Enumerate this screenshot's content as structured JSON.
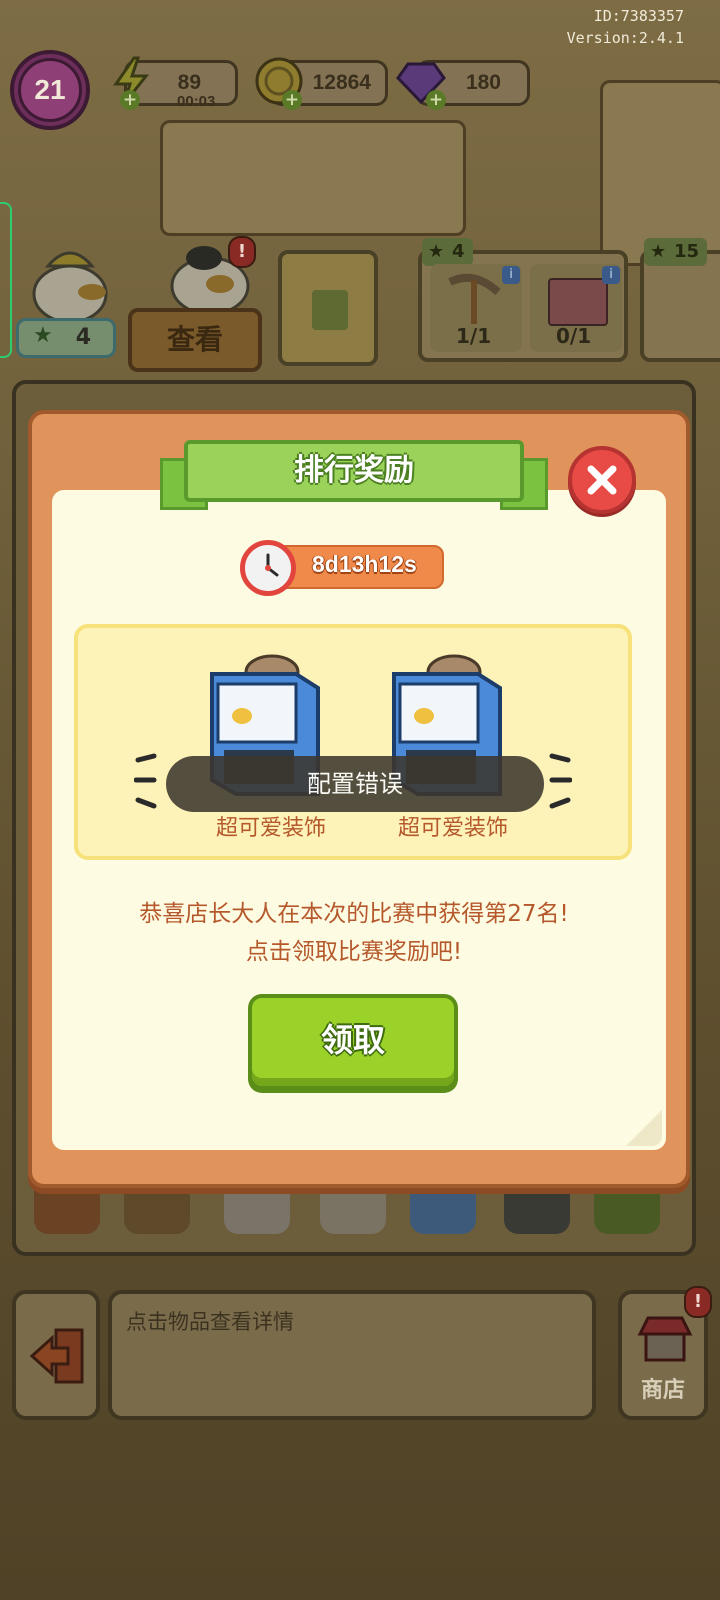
{
  "header": {
    "id_text": "ID:7383357",
    "version_text": "Version:2.4.1",
    "level": "21",
    "energy": {
      "value": "89",
      "timer": "00:03",
      "icon": "lightning-icon"
    },
    "coins": {
      "value": "12864",
      "icon": "coin-icon"
    },
    "gems": {
      "value": "180",
      "icon": "gem-icon"
    }
  },
  "scene": {
    "worker_star_count": "4",
    "view_button": "查看",
    "quest_cards": [
      {
        "star": "4",
        "progress": "1/1",
        "icon": "pickaxe-icon"
      },
      {
        "star": "",
        "progress": "0/1",
        "icon": "basket-icon"
      },
      {
        "star": "15",
        "progress": "",
        "icon": "card-icon"
      }
    ],
    "hint_text": "点击物品查看详情",
    "shop_label": "商店",
    "tray_icons": [
      "sausage-icon",
      "vendor-stall-icon",
      "statue-icon",
      "mushroom-icon",
      "cpu-chip-icon",
      "tire-icon",
      "tank-icon"
    ]
  },
  "modal": {
    "title": "排行奖励",
    "countdown": "8d13h12s",
    "rewards": [
      {
        "label": "超可爱装饰",
        "icon": "vending-machine-icon"
      },
      {
        "label": "超可爱装饰",
        "icon": "vending-machine-icon"
      }
    ],
    "error_toast": "配置错误",
    "message_line1": "恭喜店长大人在本次的比赛中获得第27名!",
    "message_line2": "点击领取比赛奖励吧!",
    "claim_button": "领取"
  },
  "colors": {
    "modal_frame": "#e0935a",
    "ribbon_green": "#9ad25a",
    "claim_green": "#9ad22a",
    "close_red": "#e84a46",
    "text_brown": "#b5592c"
  }
}
